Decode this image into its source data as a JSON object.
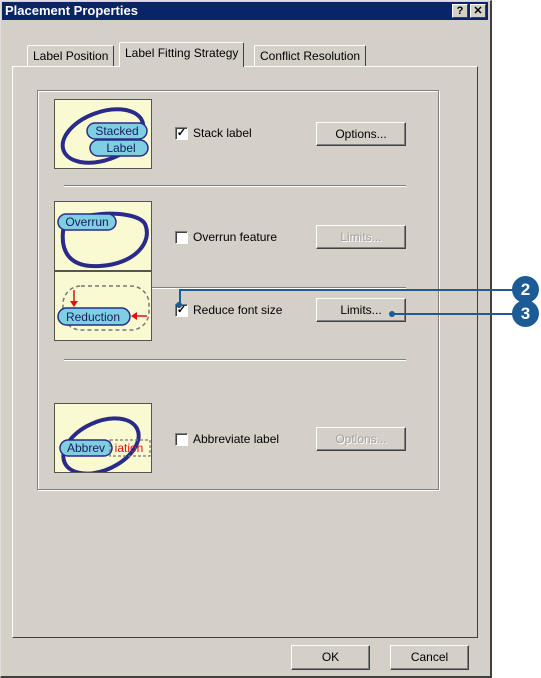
{
  "window": {
    "title": "Placement Properties",
    "help_button": "?",
    "close_button": "✕"
  },
  "tabs": [
    {
      "label": "Label Position"
    },
    {
      "label": "Label Fitting Strategy"
    },
    {
      "label": "Conflict Resolution"
    }
  ],
  "options": [
    {
      "label": "Stack label",
      "checked": true,
      "button": "Options...",
      "button_enabled": true,
      "thumb_text": [
        "Stacked",
        "Label"
      ]
    },
    {
      "label": "Overrun feature",
      "checked": false,
      "button": "Limits...",
      "button_enabled": false,
      "thumb_text": [
        "Overrun"
      ]
    },
    {
      "label": "Reduce font size",
      "checked": true,
      "button": "Limits...",
      "button_enabled": true,
      "thumb_text": [
        "Reduction"
      ]
    },
    {
      "label": "Abbreviate label",
      "checked": false,
      "button": "Options...",
      "button_enabled": false,
      "thumb_text": [
        "Abbrev",
        "iation"
      ]
    }
  ],
  "footer": {
    "ok_label": "OK",
    "cancel_label": "Cancel"
  },
  "callouts": [
    "2",
    "3"
  ],
  "colors": {
    "titlebar": "#0a246a",
    "dialog_face": "#d4d0c8",
    "thumb_bg": "#fafad2",
    "ellipse": "#2a2a8a",
    "label_fill": "#7ed0e0",
    "callout": "#1c5b96",
    "reduction_arrow": "#e01010"
  }
}
